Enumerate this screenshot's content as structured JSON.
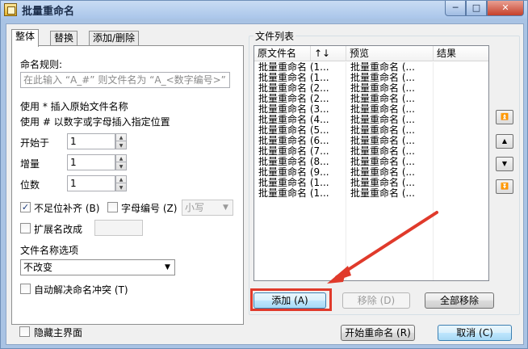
{
  "window": {
    "title": "批量重命名",
    "min_glyph": "─",
    "max_glyph": "□",
    "close_glyph": "✕"
  },
  "tabs": [
    {
      "label": "整体",
      "active": true
    },
    {
      "label": "替换",
      "active": false
    },
    {
      "label": "添加/删除",
      "active": false
    }
  ],
  "rule": {
    "label": "命名规则:",
    "placeholder": "在此输入 “A_#” 则文件名为 “A_<数字编号>”",
    "hint1": "使用 * 插入原始文件名称",
    "hint2": "使用 # 以数字或字母插入指定位置"
  },
  "fields": {
    "start_label": "开始于",
    "start_value": "1",
    "step_label": "增量",
    "step_value": "1",
    "digits_label": "位数",
    "digits_value": "1"
  },
  "options": {
    "pad_label": "不足位补齐 (B)",
    "pad_checked": true,
    "letter_label": "字母编号 (Z)",
    "letter_checked": false,
    "case_value": "小写",
    "ext_label": "扩展名改成",
    "ext_checked": false,
    "name_option_label": "文件名称选项",
    "name_option_value": "不改变",
    "auto_resolve_label": "自动解决命名冲突 (T)",
    "auto_resolve_checked": false
  },
  "file_list": {
    "group_title": "文件列表",
    "col_original": "原文件名",
    "col_sort_glyph": "↑↓",
    "col_preview": "预览",
    "col_result": "结果",
    "rows": [
      {
        "original": "批量重命名 (1...",
        "preview": "批量重命名 (..."
      },
      {
        "original": "批量重命名 (1...",
        "preview": "批量重命名 (..."
      },
      {
        "original": "批量重命名 (2...",
        "preview": "批量重命名 (..."
      },
      {
        "original": "批量重命名 (2...",
        "preview": "批量重命名 (..."
      },
      {
        "original": "批量重命名 (3...",
        "preview": "批量重命名 (..."
      },
      {
        "original": "批量重命名 (4...",
        "preview": "批量重命名 (..."
      },
      {
        "original": "批量重命名 (5...",
        "preview": "批量重命名 (..."
      },
      {
        "original": "批量重命名 (6...",
        "preview": "批量重命名 (..."
      },
      {
        "original": "批量重命名 (7...",
        "preview": "批量重命名 (..."
      },
      {
        "original": "批量重命名 (8...",
        "preview": "批量重命名 (..."
      },
      {
        "original": "批量重命名 (9...",
        "preview": "批量重命名 (..."
      },
      {
        "original": "批量重命名 (1...",
        "preview": "批量重命名 (..."
      },
      {
        "original": "批量重命名 (1...",
        "preview": "批量重命名 (..."
      }
    ]
  },
  "side_buttons": {
    "top_glyph": "⏫",
    "up_glyph": "▲",
    "down_glyph": "▼",
    "bottom_glyph": "⏬"
  },
  "buttons": {
    "add": "添加 (A)",
    "remove": "移除 (D)",
    "clear_all": "全部移除",
    "start": "开始重命名 (R)",
    "cancel": "取消 (C)"
  },
  "footer": {
    "hide_main_label": "隐藏主界面",
    "hide_main_checked": false
  },
  "colors": {
    "annotation_red": "#e03a2b",
    "title_bar": "#aac6ea"
  }
}
